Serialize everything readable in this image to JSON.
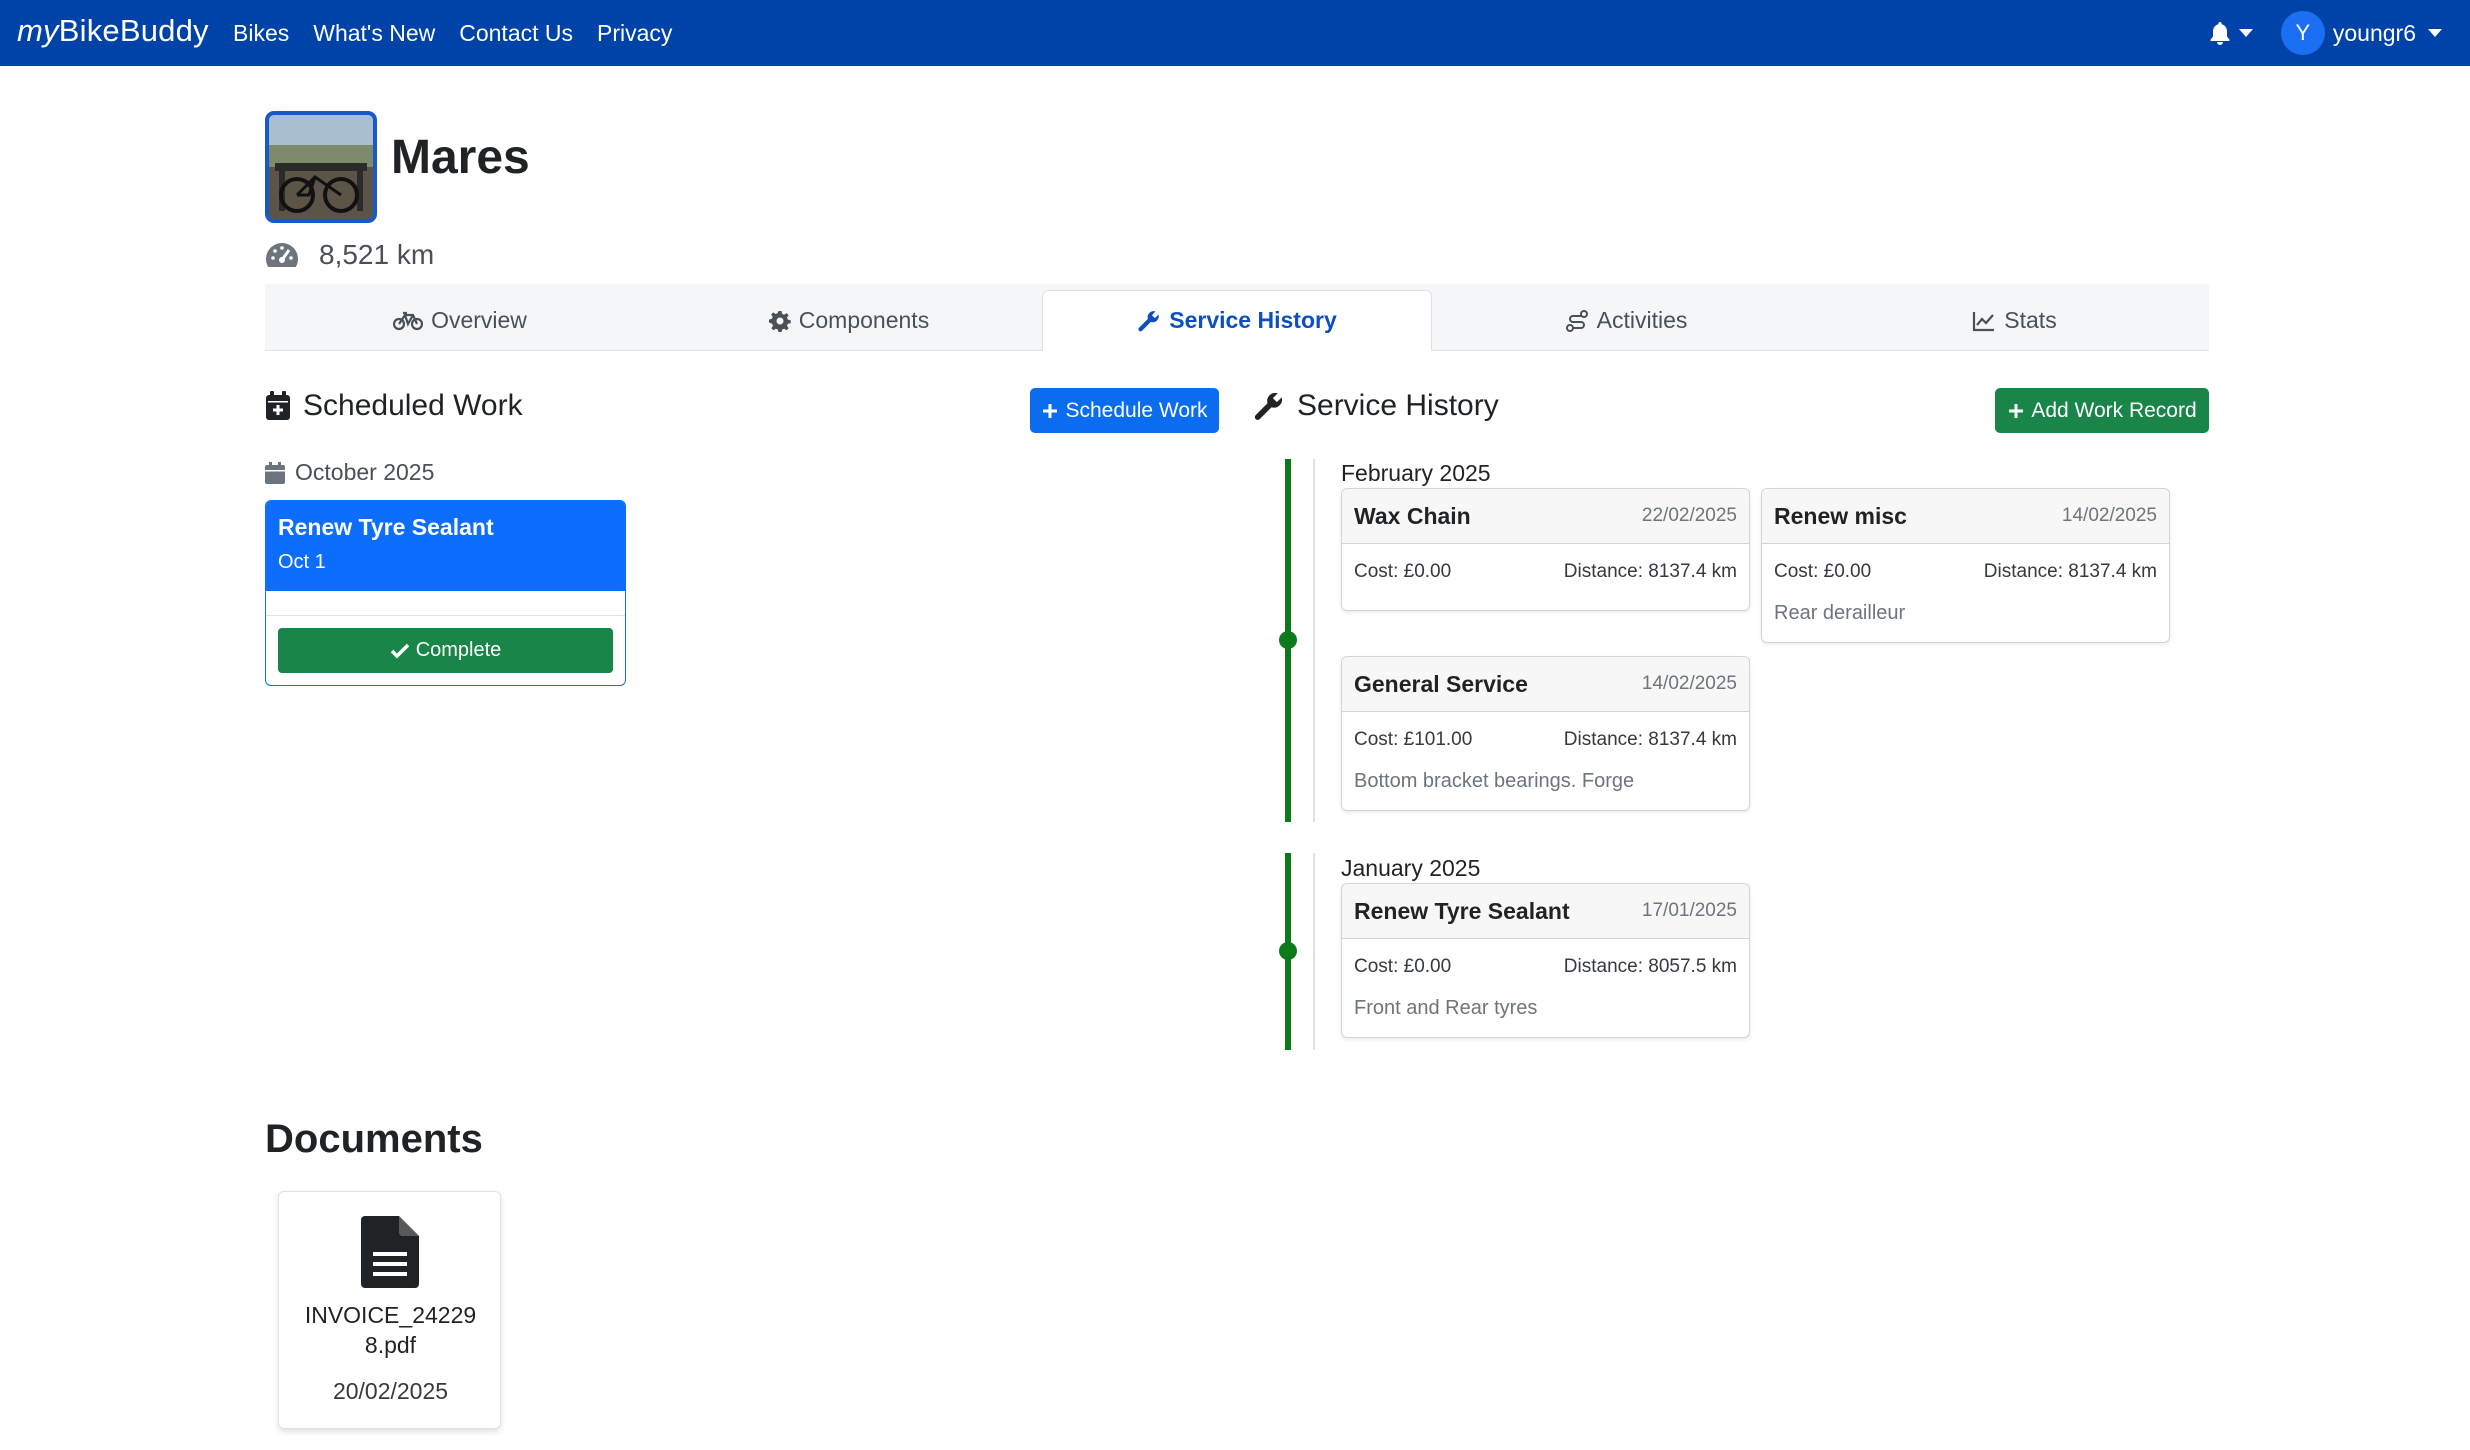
{
  "nav": {
    "brand_prefix": "my",
    "brand_rest": "BikeBuddy",
    "links": [
      "Bikes",
      "What's New",
      "Contact Us",
      "Privacy"
    ],
    "user_initial": "Y",
    "username": "youngr6"
  },
  "bike": {
    "name": "Mares",
    "odometer": "8,521 km"
  },
  "tabs": [
    "Overview",
    "Components",
    "Service History",
    "Activities",
    "Stats"
  ],
  "active_tab": "Service History",
  "scheduled": {
    "title": "Scheduled Work",
    "button_label": "Schedule Work",
    "month": "October 2025",
    "items": [
      {
        "name": "Renew Tyre Sealant",
        "date": "Oct 1",
        "action": "Complete"
      }
    ]
  },
  "service_history": {
    "title": "Service History",
    "button_label": "Add Work Record",
    "groups": [
      {
        "month": "February 2025",
        "records": [
          {
            "name": "Wax Chain",
            "date": "22/02/2025",
            "cost": "Cost: £0.00",
            "distance": "Distance: 8137.4 km",
            "note": ""
          },
          {
            "name": "Renew misc",
            "date": "14/02/2025",
            "cost": "Cost: £0.00",
            "distance": "Distance: 8137.4 km",
            "note": "Rear derailleur"
          },
          {
            "name": "General Service",
            "date": "14/02/2025",
            "cost": "Cost: £101.00",
            "distance": "Distance: 8137.4 km",
            "note": "Bottom bracket bearings. Forge"
          }
        ]
      },
      {
        "month": "January 2025",
        "records": [
          {
            "name": "Renew Tyre Sealant",
            "date": "17/01/2025",
            "cost": "Cost: £0.00",
            "distance": "Distance: 8057.5 km",
            "note": "Front and Rear tyres"
          }
        ]
      }
    ]
  },
  "documents": {
    "title": "Documents",
    "items": [
      {
        "name": "INVOICE_242298.pdf",
        "date": "20/02/2025"
      }
    ]
  },
  "colors": {
    "navbar": "#0043a8",
    "primary": "#0d6efd",
    "success": "#198548",
    "timeline": "#0c7a1a"
  }
}
